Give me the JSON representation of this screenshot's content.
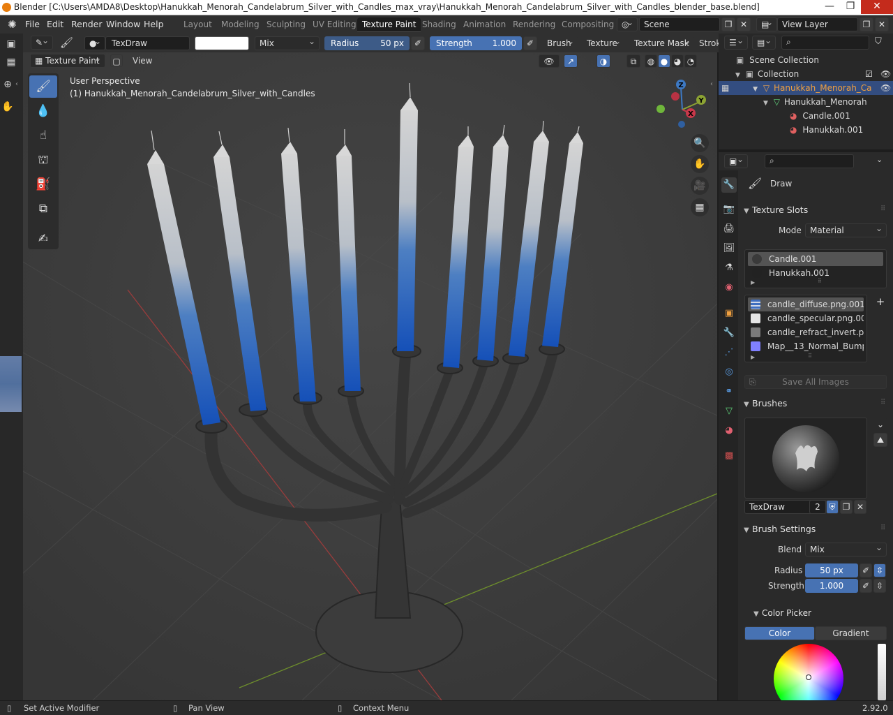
{
  "window": {
    "title": "Blender [C:\\Users\\AMDA8\\Desktop\\Hanukkah_Menorah_Candelabrum_Silver_with_Candles_max_vray\\Hanukkah_Menorah_Candelabrum_Silver_with_Candles_blender_base.blend]",
    "minimize": "—",
    "maximize": "❐",
    "close": "✕"
  },
  "menu": {
    "items": [
      "File",
      "Edit",
      "Render",
      "Window",
      "Help"
    ]
  },
  "workspaces": {
    "tabs": [
      "Layout",
      "Modeling",
      "Sculpting",
      "UV Editing",
      "Texture Paint",
      "Shading",
      "Animation",
      "Rendering",
      "Compositing"
    ],
    "active": "Texture Paint"
  },
  "scene": {
    "name": "Scene",
    "view_layer": "View Layer"
  },
  "toolheader": {
    "brush_name": "TexDraw",
    "blend": "Mix",
    "radius_label": "Radius",
    "radius_value": "50 px",
    "strength_label": "Strength",
    "strength_value": "1.000",
    "menus": [
      "Brush",
      "Texture",
      "Texture Mask",
      "Strok"
    ]
  },
  "viewport": {
    "mode": "Texture Paint",
    "view_menu": "View",
    "info_line1": "User Perspective",
    "info_line2": "(1) Hanukkah_Menorah_Candelabrum_Silver_with_Candles",
    "gizmo": {
      "x": "X",
      "y": "Y",
      "z": "Z"
    },
    "colors": {
      "candle_top": "#cfcfcf",
      "candle_bottom": "#1f5fc0",
      "metal": "#3a3a3a",
      "bg": "#3f3f3f"
    }
  },
  "outliner": {
    "search_placeholder": "",
    "rows": [
      {
        "label": "Scene Collection"
      },
      {
        "label": "Collection"
      },
      {
        "label": "Hanukkah_Menorah_Ca"
      },
      {
        "label": "Hanukkah_Menorah"
      },
      {
        "label": "Candle.001"
      },
      {
        "label": "Hanukkah.001"
      }
    ]
  },
  "properties": {
    "search_placeholder": "",
    "tool_name": "Draw",
    "texture_slots": {
      "header": "Texture Slots",
      "mode_label": "Mode",
      "mode_value": "Material",
      "materials": [
        "Candle.001",
        "Hanukkah.001"
      ],
      "images": [
        "candle_diffuse.png.001",
        "candle_specular.png.001",
        "candle_refract_invert.png....",
        "Map__13_Normal_Bump.t..."
      ],
      "save_all": "Save All Images"
    },
    "brushes": {
      "header": "Brushes",
      "brush_name": "TexDraw",
      "users": "2"
    },
    "brush_settings": {
      "header": "Brush Settings",
      "blend_label": "Blend",
      "blend_value": "Mix",
      "radius_label": "Radius",
      "radius_value": "50 px",
      "strength_label": "Strength",
      "strength_value": "1.000",
      "color_picker_header": "Color Picker",
      "color_tab": "Color",
      "gradient_tab": "Gradient"
    }
  },
  "statusbar": {
    "left": "Set Active Modifier",
    "middle": "Pan View",
    "right": "Context Menu",
    "version": "2.92.0"
  },
  "accent_color": "#4772b3"
}
